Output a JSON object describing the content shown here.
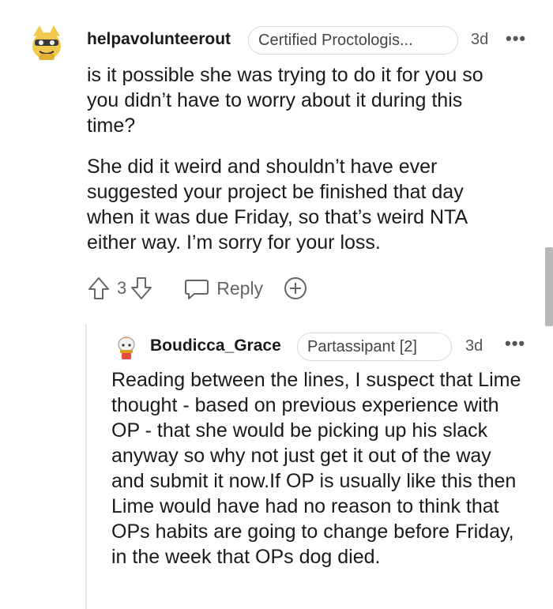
{
  "comments": [
    {
      "username": "helpavolunteerout",
      "flair": "Certified Proctologis...",
      "time": "3d",
      "more": "•••",
      "avatar_icon": "snoo-avatar-yellow",
      "paragraphs": [
        "is it possible she was trying to do it for you so you didn’t have to worry about it during this time?",
        "She did it weird and shouldn’t have ever suggested your project be finished that day when it was due Friday, so that’s weird NTA either way. I’m sorry for your loss."
      ],
      "votes": "3",
      "reply_label": "Reply"
    },
    {
      "username": "Boudicca_Grace",
      "flair": "Partassipant [2]",
      "time": "3d",
      "more": "•••",
      "avatar_icon": "snoo-avatar-orange",
      "paragraphs": [
        "Reading between the lines, I suspect that Lime thought - based on previous experience with OP - that she would be picking up his slack anyway so why not just get it out of the way and submit it now.If OP is usually like this then Lime would have had no reason to think that OPs habits are going to change before Friday, in the week that OPs dog died."
      ]
    }
  ],
  "colors": {
    "text": "#1a1a1b",
    "muted": "#666666",
    "flair_border": "#d7d9db"
  }
}
